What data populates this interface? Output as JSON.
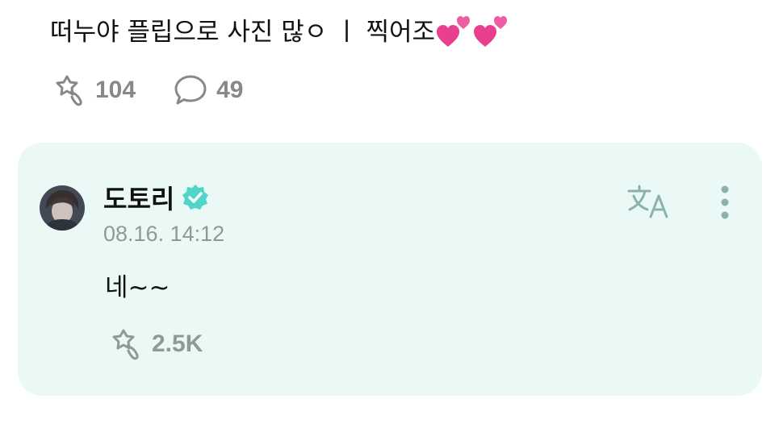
{
  "post": {
    "text": "떠누야 플립으로 사진 많ㅇ ㅣ  찍어조",
    "trailing_emoji": "two-hearts-emoji",
    "likes_count": "104",
    "comments_count": "49"
  },
  "reply": {
    "author_name": "도토리",
    "verified": true,
    "timestamp": "08.16. 14:12",
    "text": "네~~",
    "likes_count": "2.5K",
    "translate_icon": "translate-icon",
    "more_icon": "more-vertical-icon"
  },
  "colors": {
    "card_background": "#ebf9f6",
    "verified_badge": "#4fd6c8",
    "muted_text": "#8d9a98",
    "stat_gray": "#888888"
  }
}
